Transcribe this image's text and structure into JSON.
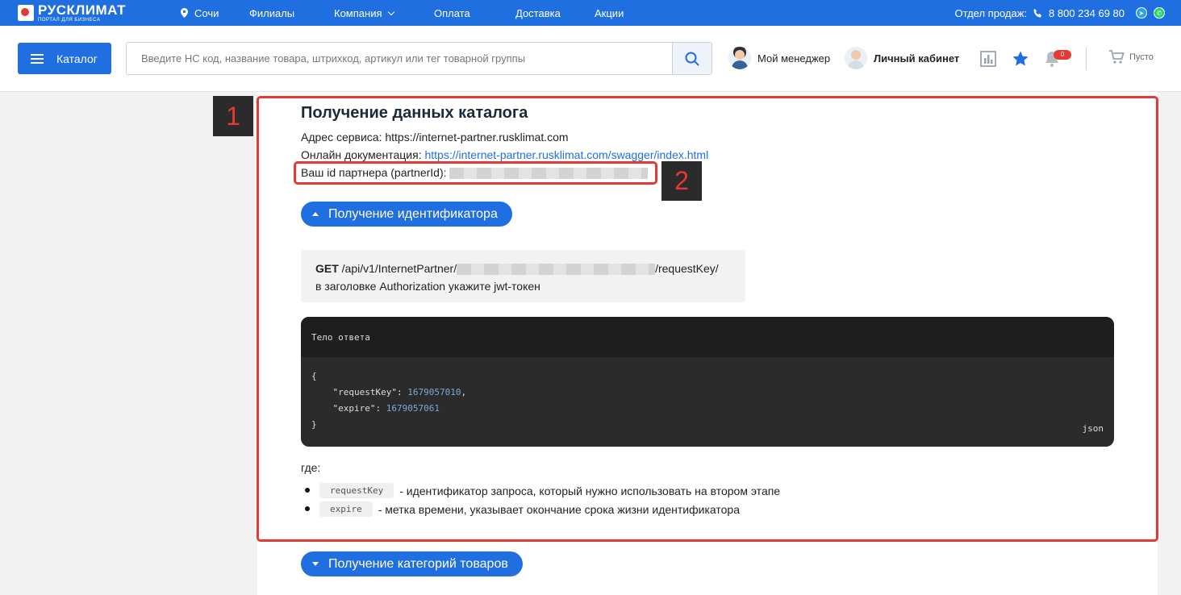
{
  "colors": {
    "brand_blue": "#1f6fe0",
    "annotation_red": "#e53935",
    "code_bg": "#2b2b2b"
  },
  "topbar": {
    "logo_title": "РУСКЛИМАТ",
    "logo_subtitle": "ПОРТАЛ ДЛЯ БИЗНЕСА",
    "city": "Сочи",
    "nav": [
      "Филиалы",
      "Компания",
      "Оплата",
      "Доставка",
      "Акции"
    ],
    "sales_label": "Отдел продаж:",
    "phone": "8 800 234 69 80",
    "icons": [
      "location-pin-icon",
      "chevron-down-icon",
      "phone-icon",
      "telegram-icon",
      "whatsapp-icon"
    ]
  },
  "header": {
    "catalog_label": "Каталог",
    "search_placeholder": "Введите НС код, название товара, штрихкод, артикул или тег товарной группы",
    "manager_label": "Мой менеджер",
    "account_label": "Личный кабинет",
    "notifications_count": "0",
    "cart_label": "Пусто",
    "icons": [
      "menu-icon",
      "search-icon",
      "chart-icon",
      "star-icon",
      "bell-icon",
      "cart-icon"
    ]
  },
  "main": {
    "title": "Получение данных каталога",
    "service_address": "Адрес сервиса: https://internet-partner.rusklimat.com",
    "docs_label": "Онлайн документация:",
    "docs_link": "https://internet-partner.rusklimat.com/swagger/index.html",
    "partner_id_label": "Ваш id партнера (partnerId):",
    "section_open": "Получение идентификатора",
    "request": {
      "method": "GET",
      "path_prefix": "/api/v1/InternetPartner/",
      "path_suffix": "/requestKey/",
      "note": "в заголовке Authorization укажите jwt-токен"
    },
    "code": {
      "title": "Тело ответа",
      "open_brace": "{",
      "close_brace": "}",
      "key1": "\"requestKey\"",
      "val1": "1679057010",
      "key2": "\"expire\"",
      "val2": "1679057061",
      "lang": "json"
    },
    "where_label": "где:",
    "params": [
      {
        "name": "requestKey",
        "desc": "- идентификатор запроса, который нужно использовать на втором этапе"
      },
      {
        "name": "expire",
        "desc": "- метка времени, указывает окончание срока жизни идентификатора"
      }
    ],
    "section_closed": "Получение категорий товаров"
  },
  "annotations": {
    "label_1": "1",
    "label_2": "2"
  }
}
